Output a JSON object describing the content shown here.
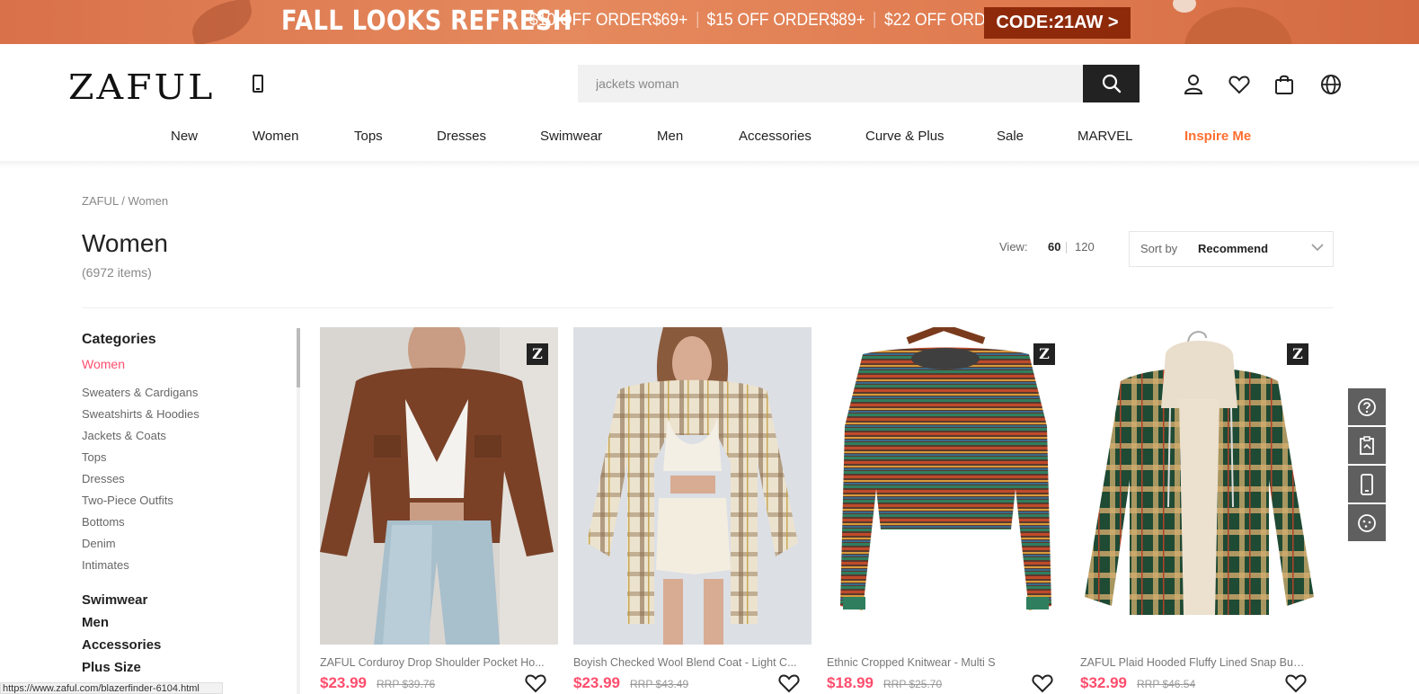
{
  "promo": {
    "headline": "FALL LOOKS REFRESH",
    "offers": [
      "$10 OFF ORDER$69+",
      "$15 OFF ORDER$89+",
      "$22 OFF ORDER$119+"
    ],
    "code": "CODE:21AW >"
  },
  "header": {
    "logo": "ZAFUL",
    "search_placeholder": "jackets woman"
  },
  "nav": {
    "items": [
      "New",
      "Women",
      "Tops",
      "Dresses",
      "Swimwear",
      "Men",
      "Accessories",
      "Curve & Plus",
      "Sale",
      "MARVEL",
      "Inspire Me"
    ],
    "highlight_color": "#ff6e2f"
  },
  "breadcrumb": "ZAFUL / Women",
  "page": {
    "title": "Women",
    "count": "(6972 items)"
  },
  "toolbar": {
    "view_label": "View:",
    "view_options": [
      "60",
      "120"
    ],
    "sort_label": "Sort by",
    "sort_value": "Recommend"
  },
  "sidebar": {
    "title": "Categories",
    "active": "Women",
    "subcategories": [
      "Sweaters & Cardigans",
      "Sweatshirts & Hoodies",
      "Jackets & Coats",
      "Tops",
      "Dresses",
      "Two-Piece Outfits",
      "Bottoms",
      "Denim",
      "Intimates"
    ],
    "main_categories": [
      "Swimwear",
      "Men",
      "Accessories",
      "Plus Size"
    ]
  },
  "products": [
    {
      "name": "ZAFUL Corduroy Drop Shoulder Pocket Ho...",
      "price": "$23.99",
      "rrp": "RRP $39.76"
    },
    {
      "name": "Boyish Checked Wool Blend Coat - Light C...",
      "price": "$23.99",
      "rrp": "RRP $43.49"
    },
    {
      "name": "Ethnic Cropped Knitwear - Multi S",
      "price": "$18.99",
      "rrp": "RRP $25.70"
    },
    {
      "name": "ZAFUL Plaid Hooded Fluffy Lined Snap But...",
      "price": "$32.99",
      "rrp": "RRP $46.54"
    }
  ],
  "badge": "Z",
  "colors": {
    "promo": "#e07b50",
    "price": "#ff4d6d",
    "promo_code_bg": "#8e2a0a"
  },
  "status_url": "https://www.zaful.com/blazerfinder-6104.html"
}
